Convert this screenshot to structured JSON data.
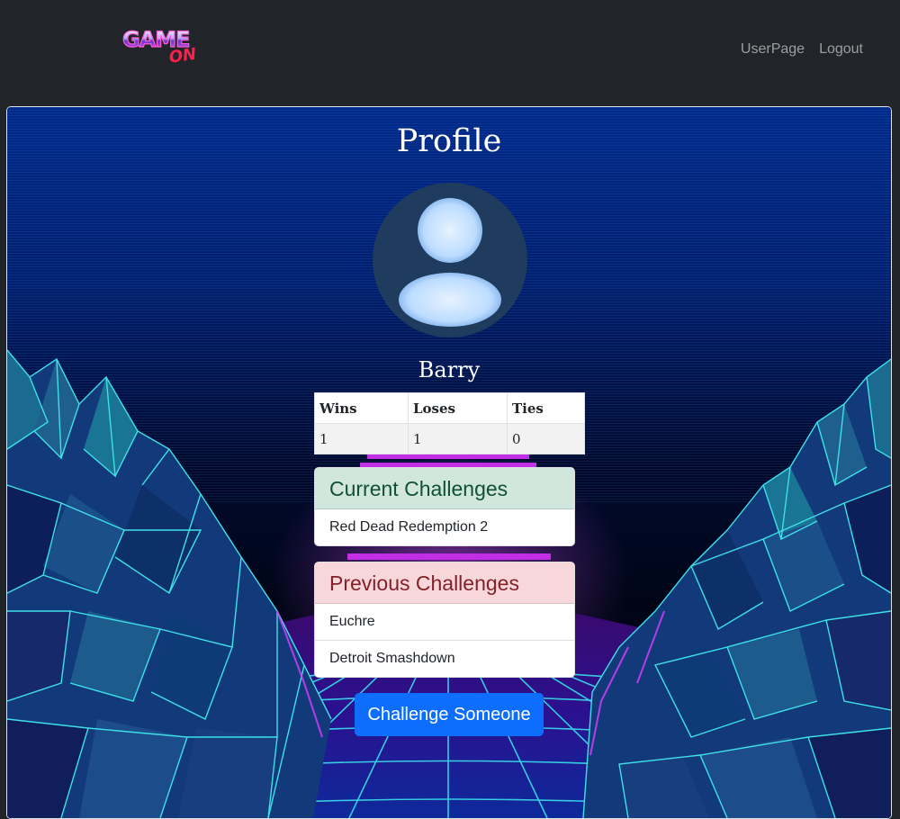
{
  "navbar": {
    "logo_text_top": "GAME",
    "logo_text_bottom": "ON",
    "links": [
      "UserPage",
      "Logout"
    ]
  },
  "profile": {
    "title": "Profile",
    "username": "Barry"
  },
  "stats": {
    "headers": [
      "Wins",
      "Loses",
      "Ties"
    ],
    "values": [
      "1",
      "1",
      "0"
    ]
  },
  "current_challenges": {
    "header": "Current Challenges",
    "items": [
      "Red Dead Redemption 2"
    ]
  },
  "previous_challenges": {
    "header": "Previous Challenges",
    "items": [
      "Euchre",
      "Detroit Smashdown"
    ]
  },
  "actions": {
    "challenge_label": "Challenge Someone"
  },
  "colors": {
    "navbar": "#212529",
    "primary": "#0d6efd",
    "success_bg": "#d1e7dd",
    "success_text": "#0f5132",
    "danger_bg": "#f8d7da",
    "danger_text": "#842029",
    "avatar_bg": "#1f3b5e",
    "neon_cyan": "#4fd3e0",
    "neon_magenta": "#d33cff"
  }
}
